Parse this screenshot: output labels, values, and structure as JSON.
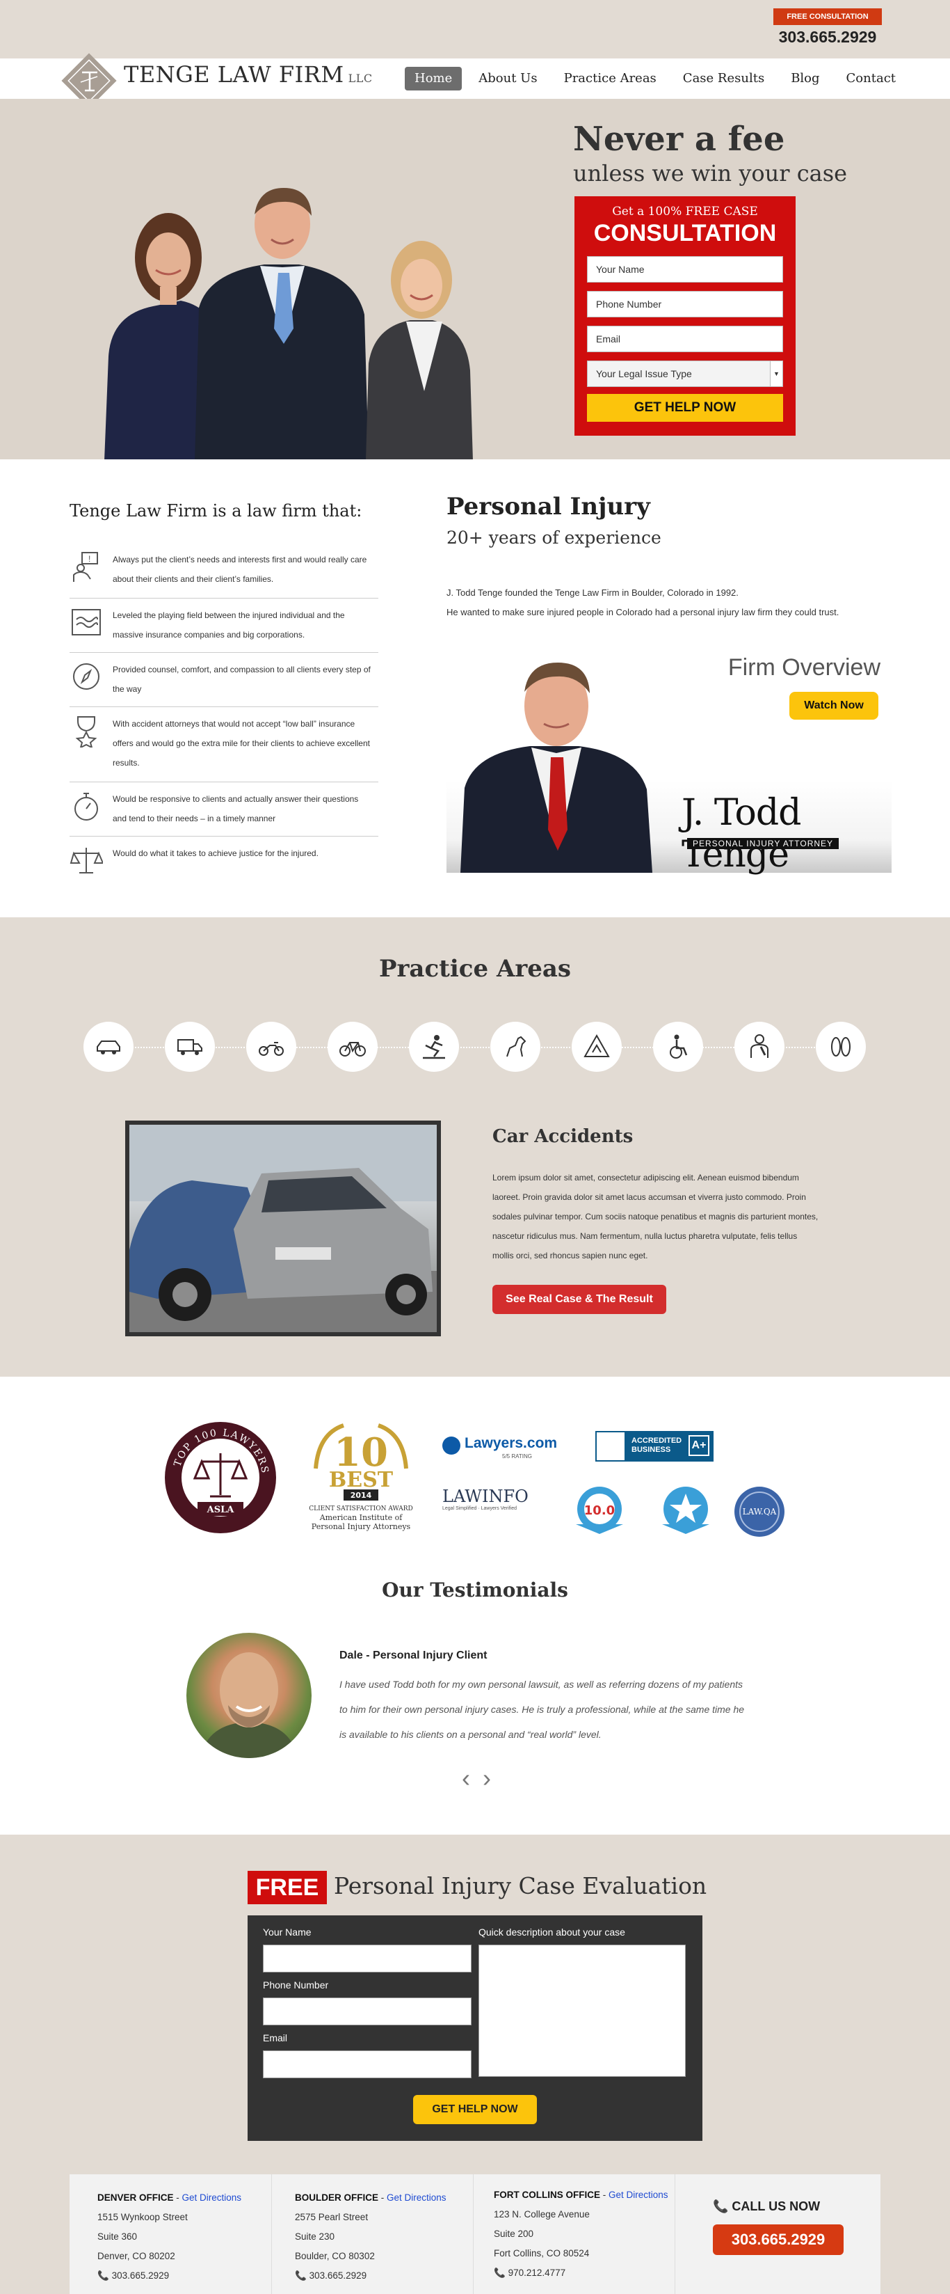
{
  "header": {
    "free_consultation_badge": "FREE CONSULTATION",
    "phone": "303.665.2929",
    "logo_text": "TENGE LAW FIRM",
    "logo_suffix": "LLC",
    "nav": [
      "Home",
      "About Us",
      "Practice Areas",
      "Case Results",
      "Blog",
      "Contact"
    ]
  },
  "hero": {
    "headline": "Never a fee",
    "subheadline": "unless we win your case",
    "form": {
      "line1": "Get a 100% FREE CASE",
      "line2": "CONSULTATION",
      "name_placeholder": "Your Name",
      "phone_placeholder": "Phone Number",
      "email_placeholder": "Email",
      "issue_select": "Your Legal Issue Type",
      "submit": "GET HELP NOW"
    }
  },
  "about": {
    "heading": "Tenge Law Firm is a law firm that:",
    "bullets": [
      {
        "icon": "person-speech-icon",
        "text": "Always put the client’s needs and interests first and would really care about their clients and their client’s families."
      },
      {
        "icon": "waves-icon",
        "text": "Leveled the playing field between the injured individual and the massive insurance companies and big corporations."
      },
      {
        "icon": "compass-icon",
        "text": "Provided counsel, comfort, and compassion to all clients every step of the way"
      },
      {
        "icon": "trophy-star-icon",
        "text": "With accident attorneys that would not accept “low ball” insurance offers and would go the extra mile for their clients to achieve excellent results."
      },
      {
        "icon": "stopwatch-icon",
        "text": "Would be responsive to clients and actually answer their questions and tend to their needs – in a timely manner"
      },
      {
        "icon": "scales-icon",
        "text": "Would do what it takes to achieve justice for the injured."
      }
    ]
  },
  "personal_injury": {
    "title": "Personal Injury",
    "subtitle": "20+ years of experience",
    "para1": "J. Todd Tenge founded the Tenge Law Firm in Boulder, Colorado in 1992.",
    "para2": "He wanted to make sure injured people in Colorado had a personal injury law firm they could trust.",
    "video_title": "Firm Overview",
    "watch_button": "Watch Now",
    "signature_name": "J. Todd Tenge",
    "signature_role": "PERSONAL INJURY ATTORNEY"
  },
  "practice": {
    "heading": "Practice Areas",
    "icons": [
      "car-icon",
      "truck-icon",
      "motorcycle-icon",
      "bicycle-icon",
      "slip-fall-icon",
      "dog-bite-icon",
      "construction-icon",
      "wheelchair-icon",
      "injury-icon",
      "footprints-icon"
    ],
    "active_title": "Car Accidents",
    "active_text": "Lorem ipsum dolor sit amet, consectetur adipiscing elit. Aenean euismod bibendum laoreet. Proin gravida dolor sit amet lacus accumsan et viverra justo commodo. Proin sodales pulvinar tempor. Cum sociis natoque penatibus et magnis dis parturient montes, nascetur ridiculus mus. Nam fermentum, nulla luctus pharetra vulputate, felis tellus mollis orci, sed rhoncus sapien nunc eget.",
    "button": "See Real Case & The Result"
  },
  "badges": {
    "top100": "TOP 100 LAWYERS",
    "asla": "ASLA",
    "best_number": "10",
    "best_word": "BEST",
    "best_year": "2014",
    "client_award": "CLIENT SATISFACTION AWARD",
    "aipia": "American Institute of Personal Injury Attorneys",
    "lawyers_com": "Lawyers.com",
    "lawyers_rating": "5/5 RATING",
    "bbb": "ACCREDITED BUSINESS",
    "bbb_grade": "A+",
    "lawinfo": "LAWINFO",
    "lawinfo_sub": "Legal Simplified · Lawyers Verified",
    "avvo_score": "10.0",
    "lawqa": "LAW.QA"
  },
  "testimonials": {
    "heading": "Our Testimonials",
    "name": "Dale - Personal Injury Client",
    "quote": "I have used Todd both for my own personal lawsuit, as well as referring dozens of my patients to him for their own personal injury cases. He is truly a professional, while at the same time he is available to his clients on a personal and “real world” level.",
    "prev": "‹",
    "next": "›"
  },
  "evaluation": {
    "free": "FREE",
    "title": "Personal Injury Case Evaluation",
    "name_label": "Your Name",
    "phone_label": "Phone Number",
    "email_label": "Email",
    "desc_label": "Quick description about your case",
    "submit": "GET HELP NOW"
  },
  "footer": {
    "offices": [
      {
        "name": "DENVER OFFICE",
        "link": "Get Directions",
        "street": "1515 Wynkoop Street",
        "suite": "Suite 360",
        "city": "Denver, CO 80202",
        "phone": "303.665.2929"
      },
      {
        "name": "BOULDER OFFICE",
        "link": "Get Directions",
        "street": "2575 Pearl Street",
        "suite": "Suite 230",
        "city": "Boulder, CO 80302",
        "phone": "303.665.2929"
      },
      {
        "name": "FORT COLLINS OFFICE",
        "link": "Get Directions",
        "street": "123 N. College Avenue",
        "suite": "Suite 200",
        "city": "Fort Collins, CO 80524",
        "phone": "970.212.4777"
      }
    ],
    "call_now": "CALL US NOW",
    "call_phone": "303.665.2929"
  },
  "colors": {
    "beige": "#e2dbd3",
    "red": "#cf0d0d",
    "yellow": "#fcc40c",
    "dark": "#333333"
  }
}
